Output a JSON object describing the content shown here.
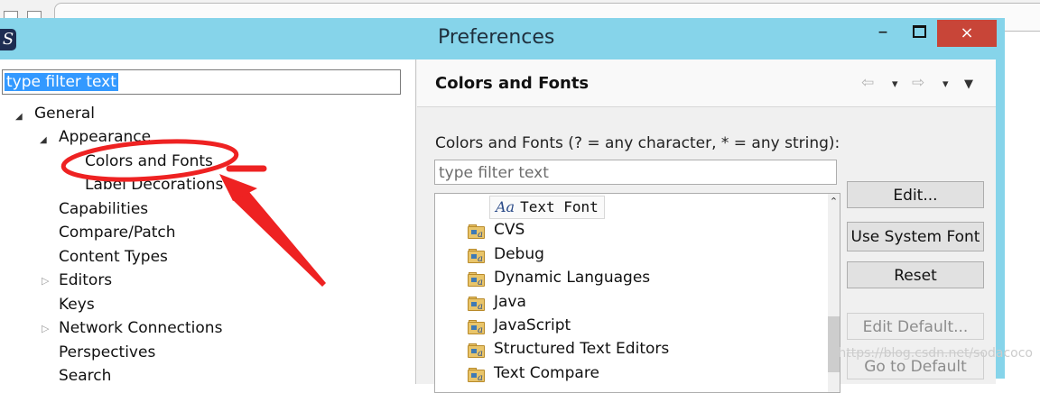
{
  "window": {
    "title": "Preferences",
    "minimize_glyph": "–",
    "close_glyph": "×"
  },
  "left": {
    "filter_value": "type filter text",
    "tree": [
      {
        "label": "General",
        "expanded": true
      },
      {
        "label": "Appearance",
        "expanded": true
      },
      {
        "label": "Colors and Fonts",
        "selected": true
      },
      {
        "label": "Label Decorations"
      },
      {
        "label": "Capabilities"
      },
      {
        "label": "Compare/Patch"
      },
      {
        "label": "Content Types"
      },
      {
        "label": "Editors",
        "expanded": false
      },
      {
        "label": "Keys"
      },
      {
        "label": "Network Connections",
        "expanded": false
      },
      {
        "label": "Perspectives"
      },
      {
        "label": "Search"
      }
    ]
  },
  "right": {
    "title": "Colors and Fonts",
    "description": "Colors and Fonts (? = any character, * = any string):",
    "filter_placeholder": "type filter text",
    "font_item": {
      "icon_text": "Aa",
      "label": "Text Font"
    },
    "categories": [
      "CVS",
      "Debug",
      "Dynamic Languages",
      "Java",
      "JavaScript",
      "Structured Text Editors",
      "Text Compare"
    ],
    "buttons": {
      "edit": "Edit...",
      "use_system_font": "Use System Font",
      "reset": "Reset",
      "edit_default": "Edit Default...",
      "go_to_default": "Go to Default"
    },
    "nav": {
      "back_glyph": "⇦",
      "forward_glyph": "⇨",
      "dropdown_glyph": "▾",
      "menu_glyph": "▼"
    }
  },
  "watermark": "https://blog.csdn.net/sodacoco",
  "colors": {
    "titlebar": "#86d4ea",
    "close_button": "#c84538",
    "selection": "#3399ff",
    "annotation_red": "#ee2222"
  }
}
